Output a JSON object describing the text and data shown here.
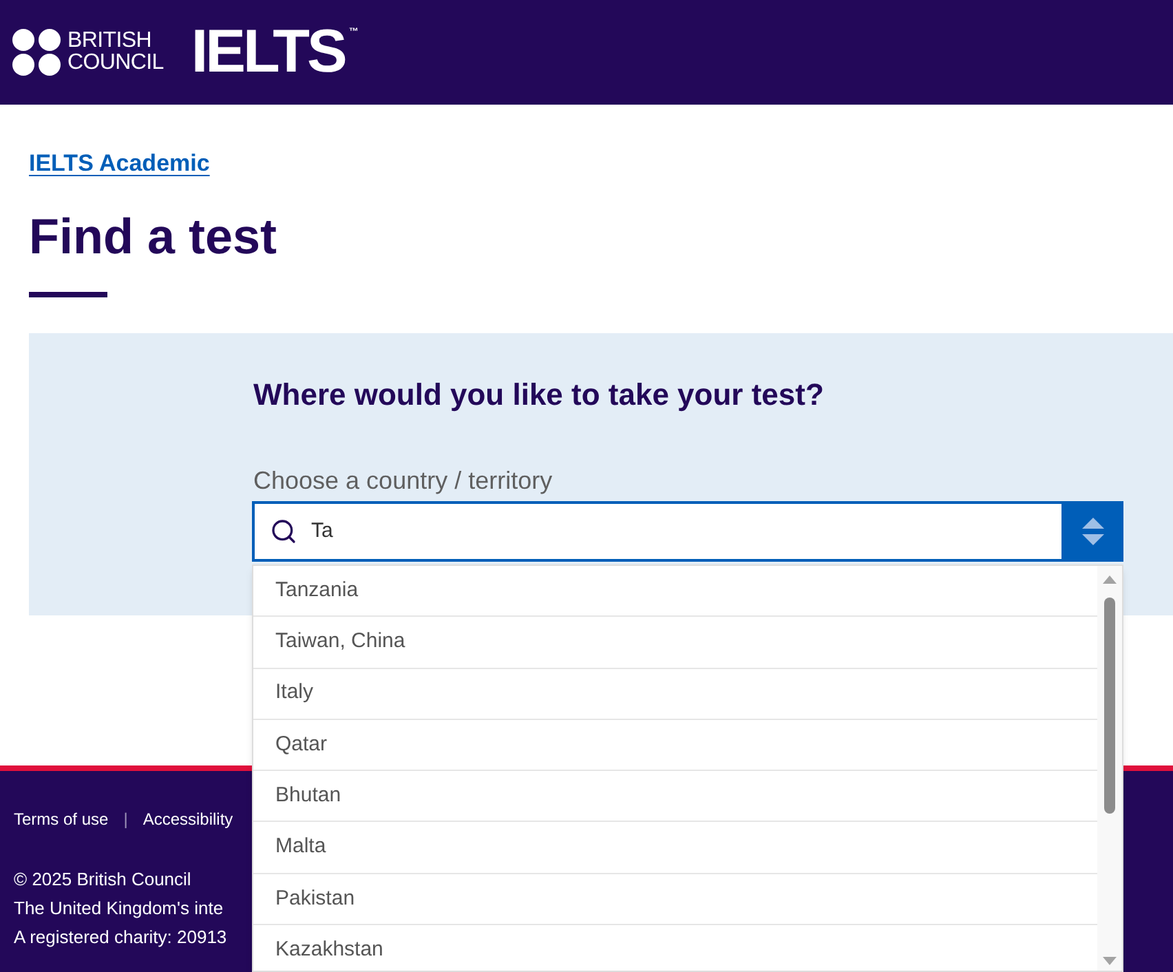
{
  "header": {
    "logo_lines": [
      "BRITISH",
      "COUNCIL"
    ],
    "brand": "IELTS",
    "trademark": "™"
  },
  "breadcrumb": {
    "label": "IELTS Academic"
  },
  "page_title": "Find a test",
  "search_panel": {
    "heading": "Where would you like to take your test?",
    "field": {
      "label": "Choose a country / territory",
      "value": "Ta",
      "expanded": true
    },
    "options": [
      {
        "label": "Tanzania",
        "selected": false
      },
      {
        "label": "Taiwan, China",
        "selected": false
      },
      {
        "label": "Italy",
        "selected": false
      },
      {
        "label": "Qatar",
        "selected": false
      },
      {
        "label": "Bhutan",
        "selected": false
      },
      {
        "label": "Malta",
        "selected": false
      },
      {
        "label": "Pakistan",
        "selected": false
      },
      {
        "label": "Kazakhstan",
        "selected": false
      }
    ]
  },
  "footer": {
    "links": [
      "Terms of use",
      "Accessibility"
    ],
    "separator": "|",
    "lines": [
      "© 2025 British Council",
      "The United Kingdom's inte",
      "A registered charity: 20913"
    ]
  }
}
